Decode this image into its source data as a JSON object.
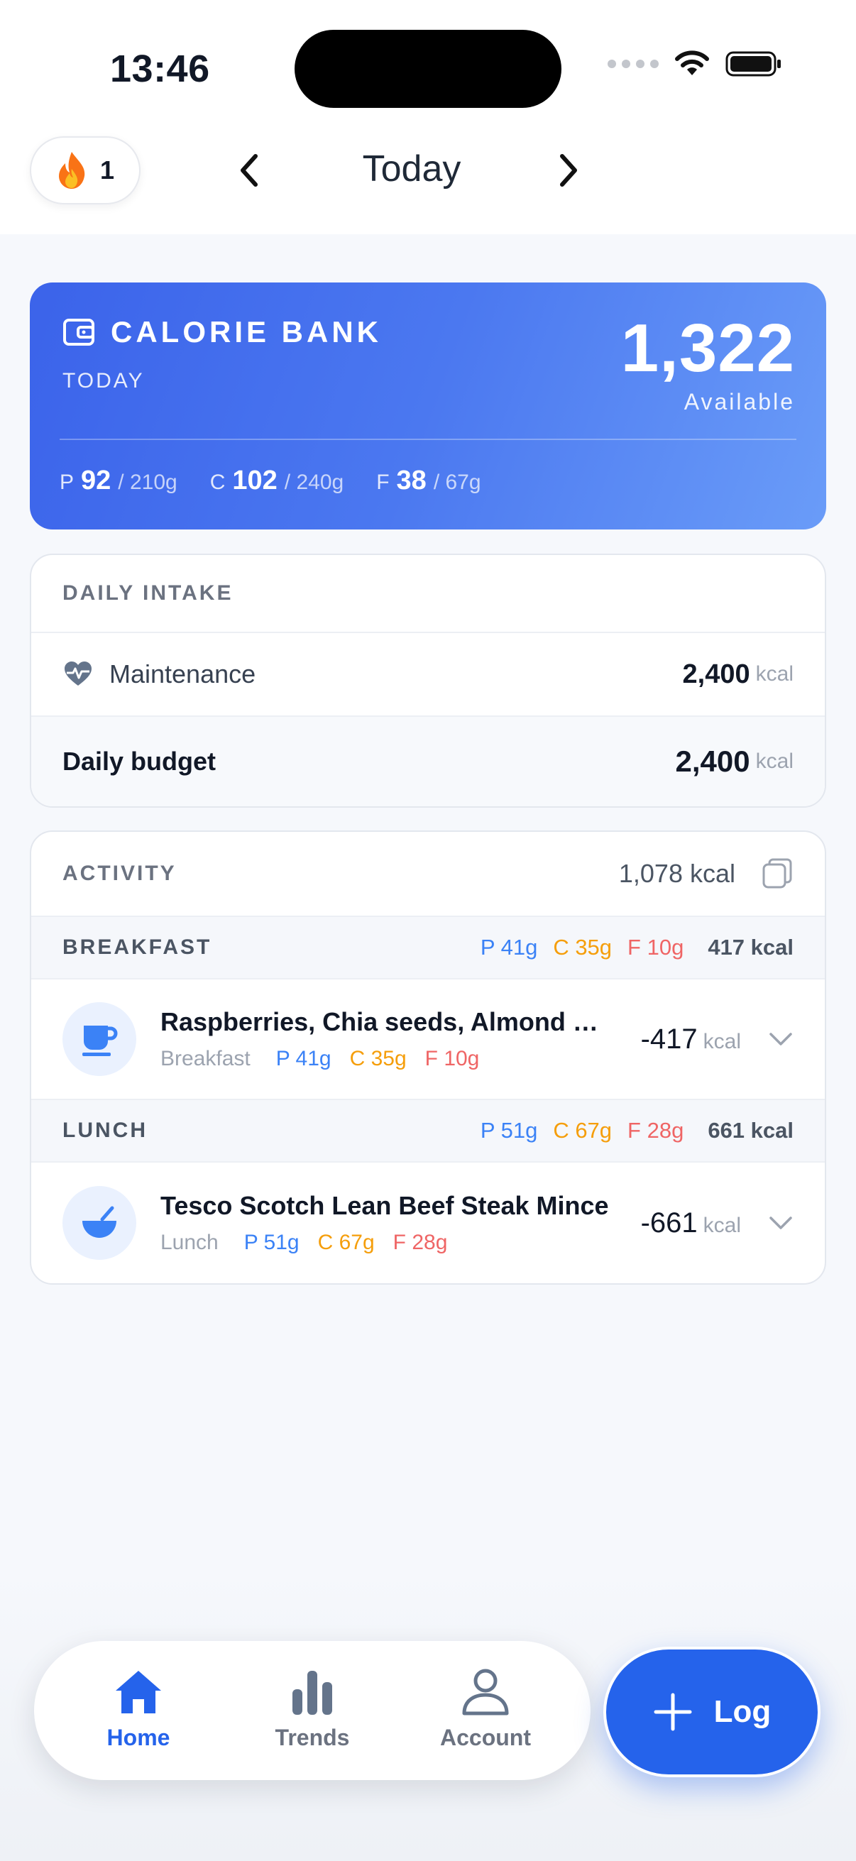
{
  "status": {
    "time": "13:46"
  },
  "header": {
    "streak_count": "1",
    "date_label": "Today"
  },
  "bank": {
    "title": "CALORIE BANK",
    "subtitle": "TODAY",
    "value": "1,322",
    "value_label": "Available",
    "macros": [
      {
        "letter": "P",
        "value": "92",
        "target": "/ 210g"
      },
      {
        "letter": "C",
        "value": "102",
        "target": "/ 240g"
      },
      {
        "letter": "F",
        "value": "38",
        "target": "/ 67g"
      }
    ]
  },
  "intake": {
    "header": "DAILY INTAKE",
    "maintenance_label": "Maintenance",
    "maintenance_value": "2,400",
    "budget_label": "Daily budget",
    "budget_value": "2,400",
    "unit": "kcal"
  },
  "activity": {
    "header": "ACTIVITY",
    "total": "1,078 kcal",
    "sections": [
      {
        "name": "BREAKFAST",
        "p": "P 41g",
        "c": "C 35g",
        "f": "F 10g",
        "kcal": "417 kcal",
        "item": {
          "name": "Raspberries, Chia seeds, Almond milk, Protein powder",
          "meal": "Breakfast",
          "p": "P 41g",
          "c": "C 35g",
          "f": "F 10g",
          "kcal": "-417",
          "unit": "kcal"
        }
      },
      {
        "name": "LUNCH",
        "p": "P 51g",
        "c": "C 67g",
        "f": "F 28g",
        "kcal": "661 kcal",
        "item": {
          "name": "Tesco Scotch Lean Beef Steak Mince",
          "meal": "Lunch",
          "p": "P 51g",
          "c": "C 67g",
          "f": "F 28g",
          "kcal": "-661",
          "unit": "kcal"
        }
      }
    ]
  },
  "tabs": {
    "home": "Home",
    "trends": "Trends",
    "account": "Account"
  },
  "log_label": "Log",
  "colors": {
    "accent": "#2563eb",
    "protein": "#3b82f6",
    "carbs": "#f59e0b",
    "fat": "#ef6565"
  }
}
